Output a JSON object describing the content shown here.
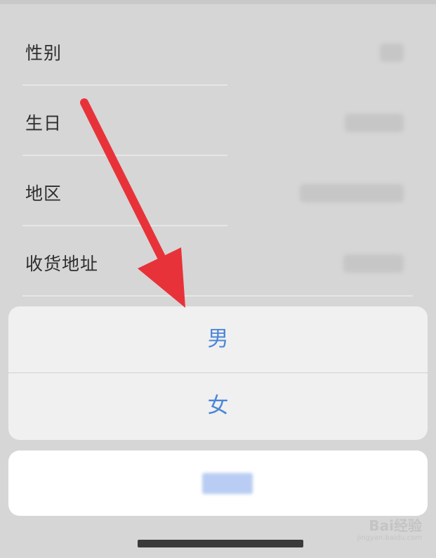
{
  "profile_rows": [
    {
      "label": "性别"
    },
    {
      "label": "生日"
    },
    {
      "label": "地区"
    },
    {
      "label": "收货地址"
    }
  ],
  "action_sheet": {
    "options": [
      "男",
      "女"
    ],
    "cancel_label": ""
  },
  "watermark": {
    "brand": "Bai经验",
    "url": "jingyan.baidu.com"
  },
  "colors": {
    "option_text": "#4a86d8",
    "annotation_arrow": "#e8323a",
    "background": "#d6d6d6"
  },
  "icons": {
    "arrow": "red-annotation-arrow"
  }
}
